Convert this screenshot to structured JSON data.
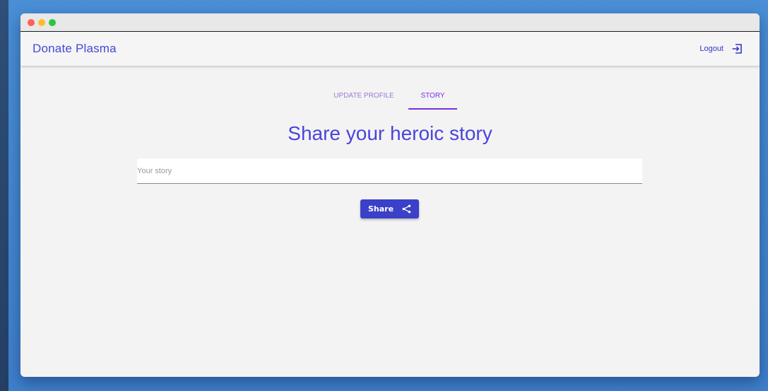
{
  "app": {
    "brand": "Donate Plasma"
  },
  "header": {
    "logout_label": "Logout",
    "logout_icon": "exit-icon"
  },
  "tabs": [
    {
      "label": "UPDATE PROFILE",
      "active": false
    },
    {
      "label": "STORY",
      "active": true
    }
  ],
  "main": {
    "heading": "Share your heroic story",
    "story_input": {
      "placeholder": "Your story",
      "value": ""
    },
    "share_button": {
      "label": "Share",
      "icon": "share-icon"
    }
  },
  "colors": {
    "accent": "#4b44db",
    "active_tab": "#7b2de0",
    "button": "#3a40c7",
    "window_dots": [
      "#fe5f57",
      "#febc2e",
      "#28c840"
    ]
  }
}
